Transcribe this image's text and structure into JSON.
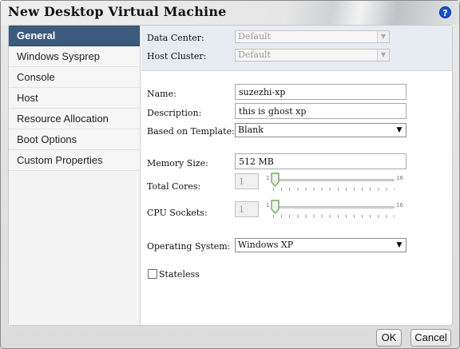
{
  "window": {
    "title": "New Desktop Virtual Machine",
    "help_icon": "question-icon"
  },
  "sidebar": {
    "items": [
      {
        "label": "General",
        "active": true
      },
      {
        "label": "Windows Sysprep",
        "active": false
      },
      {
        "label": "Console",
        "active": false
      },
      {
        "label": "Host",
        "active": false
      },
      {
        "label": "Resource Allocation",
        "active": false
      },
      {
        "label": "Boot Options",
        "active": false
      },
      {
        "label": "Custom Properties",
        "active": false
      }
    ]
  },
  "general": {
    "data_center": {
      "label": "Data Center:",
      "value": "Default"
    },
    "host_cluster": {
      "label": "Host Cluster:",
      "value": "Default"
    },
    "name": {
      "label": "Name:",
      "value": "suzezhi-xp"
    },
    "description": {
      "label": "Description:",
      "value": "this is ghost xp"
    },
    "template": {
      "label": "Based on Template:",
      "value": "Blank"
    },
    "memory": {
      "label": "Memory Size:",
      "value": "512 MB"
    },
    "total_cores": {
      "label": "Total Cores:",
      "value": "1",
      "slider_min": "1",
      "slider_max": "16"
    },
    "cpu_sockets": {
      "label": "CPU Sockets:",
      "value": "1",
      "slider_min": "1",
      "slider_max": "16"
    },
    "os": {
      "label": "Operating System:",
      "value": "Windows XP"
    },
    "stateless": {
      "label": "Stateless",
      "checked": false
    }
  },
  "footer": {
    "ok_label": "OK",
    "cancel_label": "Cancel"
  }
}
